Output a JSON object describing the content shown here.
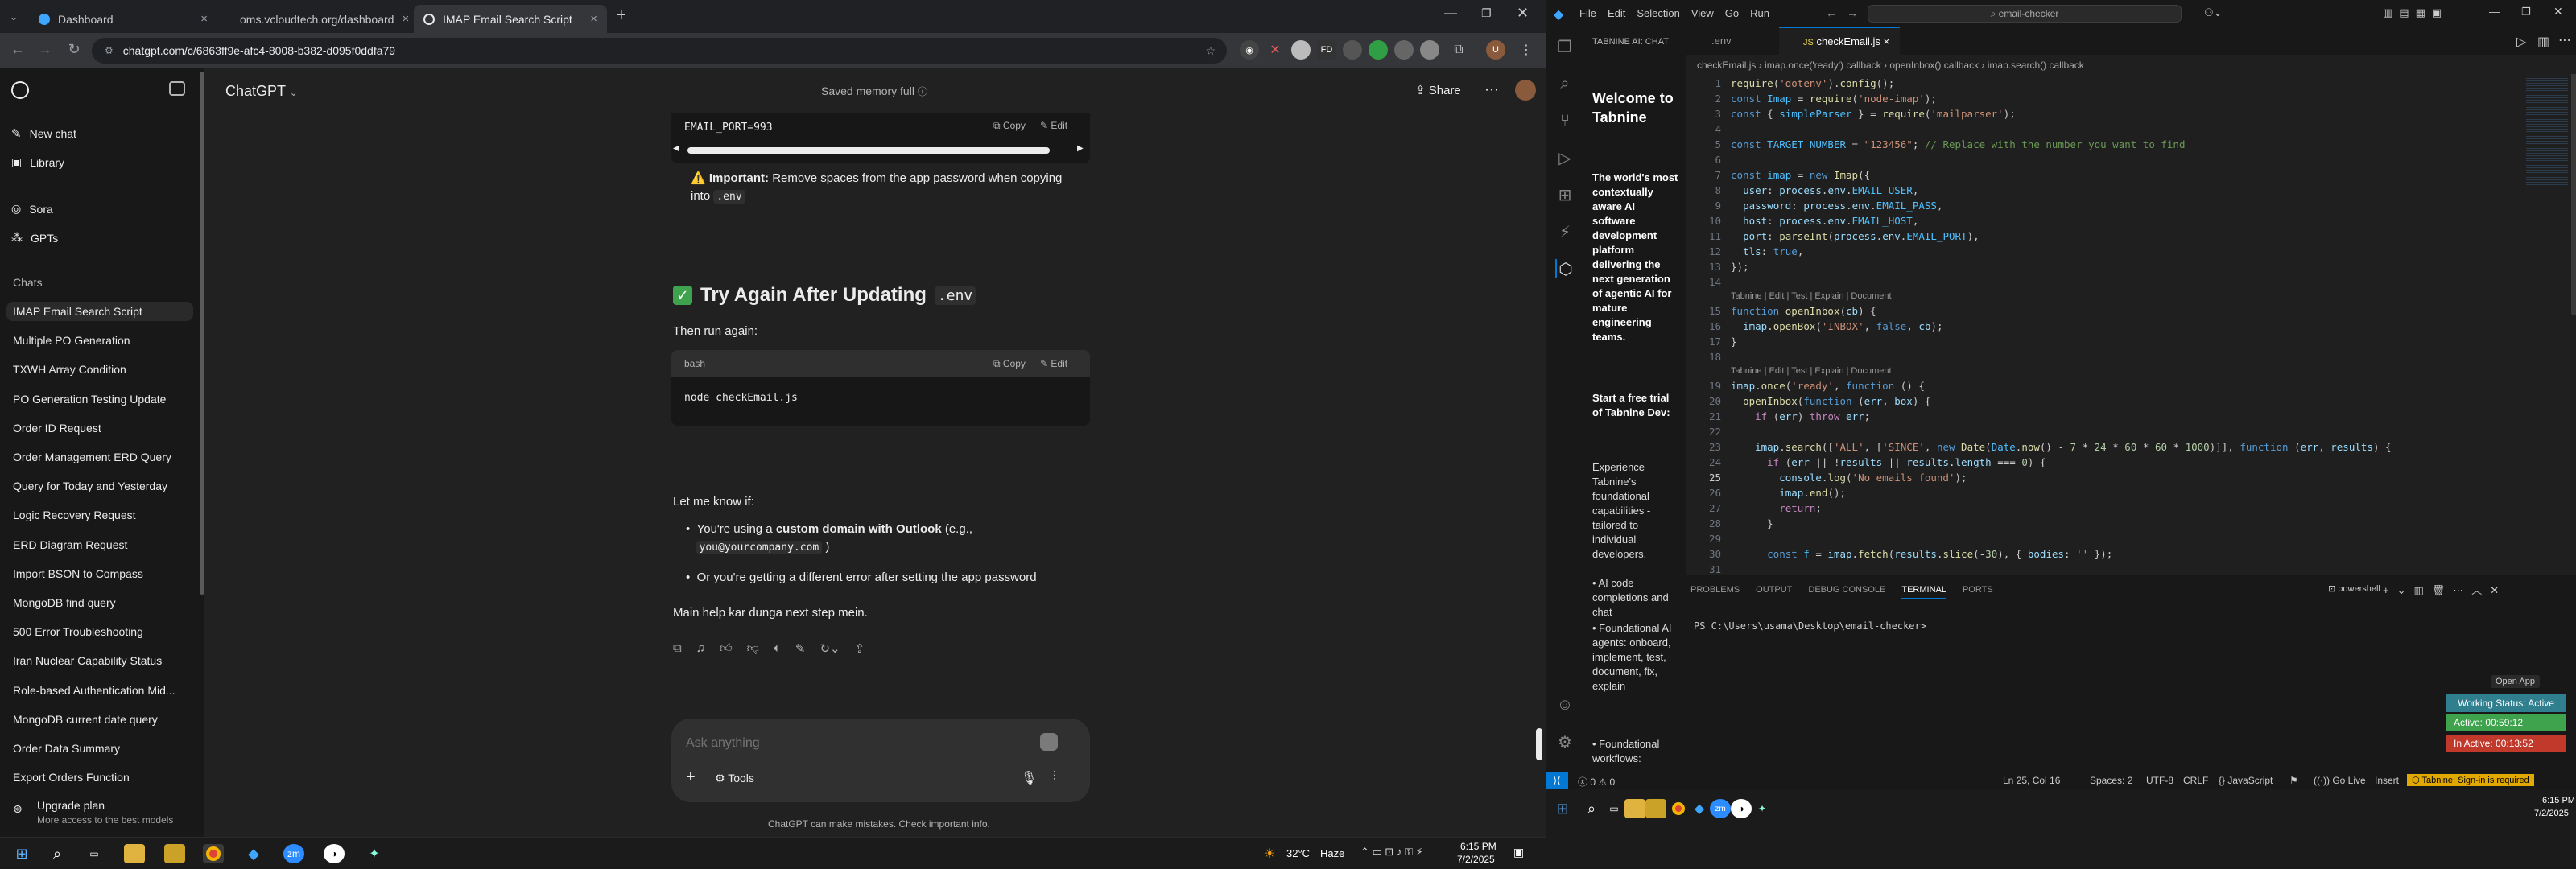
{
  "browser": {
    "tabs": [
      {
        "title": "Dashboard"
      },
      {
        "title": "oms.vcloudtech.org/dashboard"
      },
      {
        "title": "IMAP Email Search Script"
      }
    ],
    "url": "chatgpt.com/c/6863ff9e-afc4-8008-b382-d095f0ddfa79"
  },
  "sidebar": {
    "new_chat": "New chat",
    "library": "Library",
    "sora": "Sora",
    "gpts": "GPTs",
    "chats_heading": "Chats",
    "chats": [
      "IMAP Email Search Script",
      "Multiple PO Generation",
      "TXWH Array Condition",
      "PO Generation Testing Update",
      "Order ID Request",
      "Order Management ERD Query",
      "Query for Today and Yesterday",
      "Logic Recovery Request",
      "ERD Diagram Request",
      "Import BSON to Compass",
      "MongoDB find query",
      "500 Error Troubleshooting",
      "Iran Nuclear Capability Status",
      "Role-based Authentication Mid...",
      "MongoDB current date query",
      "Order Data Summary",
      "Export Orders Function"
    ],
    "upgrade_title": "Upgrade plan",
    "upgrade_sub": "More access to the best models"
  },
  "header": {
    "model": "ChatGPT",
    "memory": "Saved memory full",
    "share": "Share"
  },
  "conversation": {
    "code1": "EMAIL_PORT=993",
    "copy": "Copy",
    "edit": "Edit",
    "important_label": "Important:",
    "important_text": "Remove spaces from the app password when copying",
    "important_into": "into",
    "env_code": ".env",
    "heading": "Try Again After Updating",
    "then_run": "Then run again:",
    "bash_lang": "bash",
    "code2": "node checkEmail.js",
    "let_me_know": "Let me know if:",
    "b1_prefix": "You're using a",
    "b1_bold": "custom domain with Outlook",
    "b1_suffix": "(e.g.,",
    "b1_code": "you@yourcompany.com",
    "b1_close": ")",
    "b2": "Or you're getting a different error after setting the app password",
    "final": "Main help kar dunga next step mein."
  },
  "composer": {
    "placeholder": "Ask anything",
    "tools": "Tools",
    "disclaimer": "ChatGPT can make mistakes. Check important info."
  },
  "win_left": {
    "weather": "32°C",
    "weather_desc": "Haze",
    "time": "6:15 PM",
    "date": "7/2/2025"
  },
  "vscode": {
    "menu": [
      "File",
      "Edit",
      "Selection",
      "View",
      "Go",
      "Run"
    ],
    "search": "email-checker",
    "sidebar_title": "TABNINE AI: CHAT",
    "welcome": "Welcome to Tabnine",
    "intro": "The world's most contextually aware AI software development platform delivering the next generation of agentic AI for mature engineering teams.",
    "trial": "Start a free trial of Tabnine Dev:",
    "exp": "Experience Tabnine's foundational capabilities - tailored to individual developers.",
    "bullets": [
      "AI code completions and chat",
      "Foundational AI agents: onboard, implement, test, document, fix, explain",
      "Foundational workflows: custom..."
    ],
    "tabs": [
      ".env",
      "checkEmail.js"
    ],
    "breadcrumb": [
      "checkEmail.js",
      "imap.once('ready') callback",
      "openInbox() callback",
      "imap.search() callback"
    ],
    "lens": "Tabnine | Edit | Test | Explain | Document",
    "panel_tabs": [
      "PROBLEMS",
      "OUTPUT",
      "DEBUG CONSOLE",
      "TERMINAL",
      "PORTS"
    ],
    "shell": "powershell",
    "prompt": "PS C:\\Users\\usama\\Desktop\\email-checker>",
    "open_app": "Open App",
    "work_status": "Working Status: Active",
    "active": "Active: 00:59:12",
    "inactive": "In Active: 00:13:52",
    "status": {
      "errors": "0",
      "warnings": "0",
      "pos": "Ln 25, Col 16",
      "spaces": "Spaces: 2",
      "enc": "UTF-8",
      "eol": "CRLF",
      "lang": "JavaScript",
      "golive": "Go Live",
      "insert": "Insert",
      "tabnine": "Tabnine: Sign-in is required"
    },
    "time": "6:15 PM",
    "date": "7/2/2025"
  },
  "colors": {
    "chat_bg": "#212121",
    "sidebar_bg": "#181818",
    "vscode_bg": "#1f1f1f",
    "accent_green": "#3fa34d",
    "status_red": "#c0392b",
    "status_teal": "#2f7f8f",
    "tabnine_yellow": "#e0a800"
  }
}
